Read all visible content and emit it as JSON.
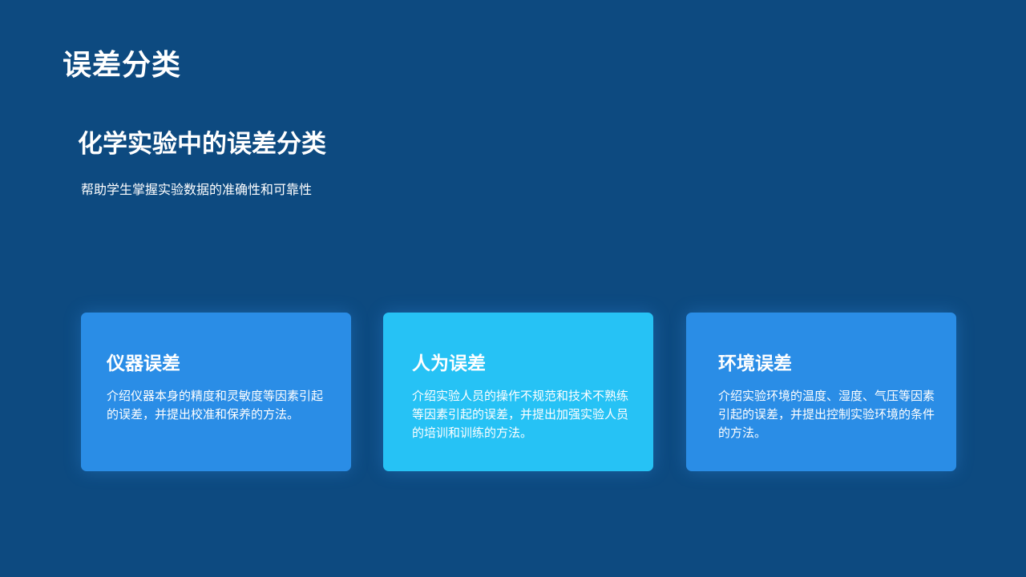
{
  "page": {
    "title": "误差分类"
  },
  "section": {
    "title": "化学实验中的误差分类",
    "subtitle": "帮助学生掌握实验数据的准确性和可靠性"
  },
  "cards": [
    {
      "title": "仪器误差",
      "body": "介绍仪器本身的精度和灵敏度等因素引起的误差，并提出校准和保养的方法。",
      "color": "#2a8de6"
    },
    {
      "title": "人为误差",
      "body": "介绍实验人员的操作不规范和技术不熟练等因素引起的误差，并提出加强实验人员的培训和训练的方法。",
      "color": "#26c2f5"
    },
    {
      "title": "环境误差",
      "body": "介绍实验环境的温度、湿度、气压等因素引起的误差，并提出控制实验环境的条件的方法。",
      "color": "#2a8de6"
    }
  ],
  "colors": {
    "background": "#0d4a80",
    "text": "#ffffff"
  }
}
